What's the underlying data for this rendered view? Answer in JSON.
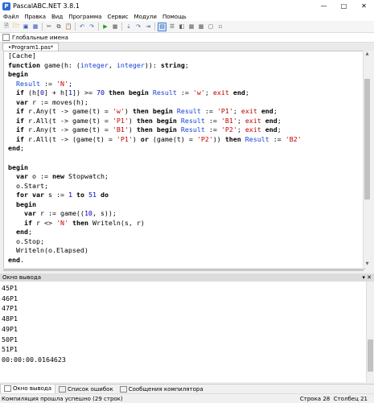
{
  "window": {
    "title": "PascalABC.NET 3.8.1"
  },
  "menu": [
    "Файл",
    "Правка",
    "Вид",
    "Программа",
    "Сервис",
    "Модули",
    "Помощь"
  ],
  "combo": {
    "value": "Глобальные имена"
  },
  "tab": {
    "label": "•Program1.pas*"
  },
  "code_lines": [
    "[Cache]",
    "function game(h: (integer, integer)): string;",
    "begin",
    "  Result := 'N';",
    "  if (h[0] + h[1]) >= 70 then begin Result := 'w'; exit end;",
    "  var r := moves(h);",
    "  if r.Any(t -> game(t) = 'w') then begin Result := 'P1'; exit end;",
    "  if r.All(t -> game(t) = 'P1') then begin Result := 'B1'; exit end;",
    "  if r.Any(t -> game(t) = 'B1') then begin Result := 'P2'; exit end;",
    "  if r.All(t -> (game(t) = 'P1') or (game(t) = 'P2')) then Result := 'B2'",
    "end;",
    "",
    "begin",
    "  var o := new Stopwatch;",
    "  o.Start;",
    "  for var s := 1 to 51 do",
    "  begin",
    "    var r := game((10, s));",
    "    if r <> 'N' then Writeln(s, r)",
    "  end;",
    "  o.Stop;",
    "  Writeln(o.Elapsed)",
    "end."
  ],
  "output_panel": {
    "title": "Окно вывода",
    "lines": [
      "45P1",
      "46P1",
      "47P1",
      "48P1",
      "49P1",
      "50P1",
      "51P1",
      "00:00:00.0164623"
    ]
  },
  "bottom_tabs": [
    "Окно вывода",
    "Список ошибок",
    "Сообщения компилятора"
  ],
  "status": {
    "message": "Компиляция прошла успешно (29 строк)",
    "row_label": "Строка",
    "row": "28",
    "col_label": "Столбец",
    "col": "21"
  }
}
